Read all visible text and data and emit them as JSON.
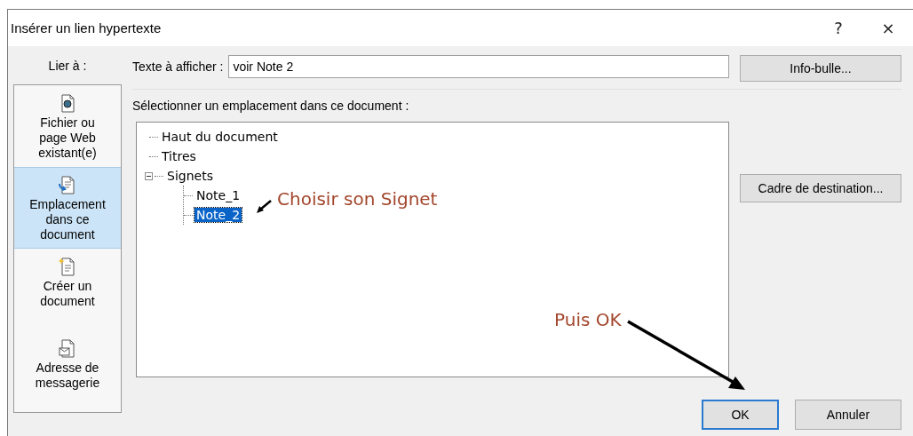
{
  "window": {
    "title": "Insérer un lien hypertexte",
    "help_button": "?",
    "close_button": "×"
  },
  "link_to": {
    "label": "Lier à :",
    "items": [
      {
        "kind": "file",
        "label": "Fichier ou\npage Web\nexistant(e)",
        "selected": false
      },
      {
        "kind": "place",
        "label": "Emplacement\ndans ce\ndocument",
        "selected": true
      },
      {
        "kind": "new",
        "label": "Créer un\ndocument",
        "selected": false
      },
      {
        "kind": "email",
        "label": "Adresse de\nmessagerie",
        "selected": false
      }
    ]
  },
  "display_text": {
    "label": "Texte à afficher :",
    "value": "voir Note 2"
  },
  "tooltip_button": "Info-bulle...",
  "location": {
    "label": "Sélectionner un emplacement dans ce document :",
    "tree": [
      {
        "label": "Haut du document",
        "selected": false
      },
      {
        "label": "Titres",
        "selected": false
      },
      {
        "label": "Signets",
        "selected": false,
        "expanded": true,
        "children": [
          {
            "label": "Note_1",
            "selected": false
          },
          {
            "label": "Note_2",
            "selected": true
          }
        ]
      }
    ]
  },
  "target_frame_button": "Cadre de destination...",
  "annotations": [
    {
      "text": "Choisir son Signet"
    },
    {
      "text": "Puis OK"
    }
  ],
  "buttons": [
    {
      "label": "OK",
      "default": true
    },
    {
      "label": "Annuler",
      "default": false
    }
  ]
}
